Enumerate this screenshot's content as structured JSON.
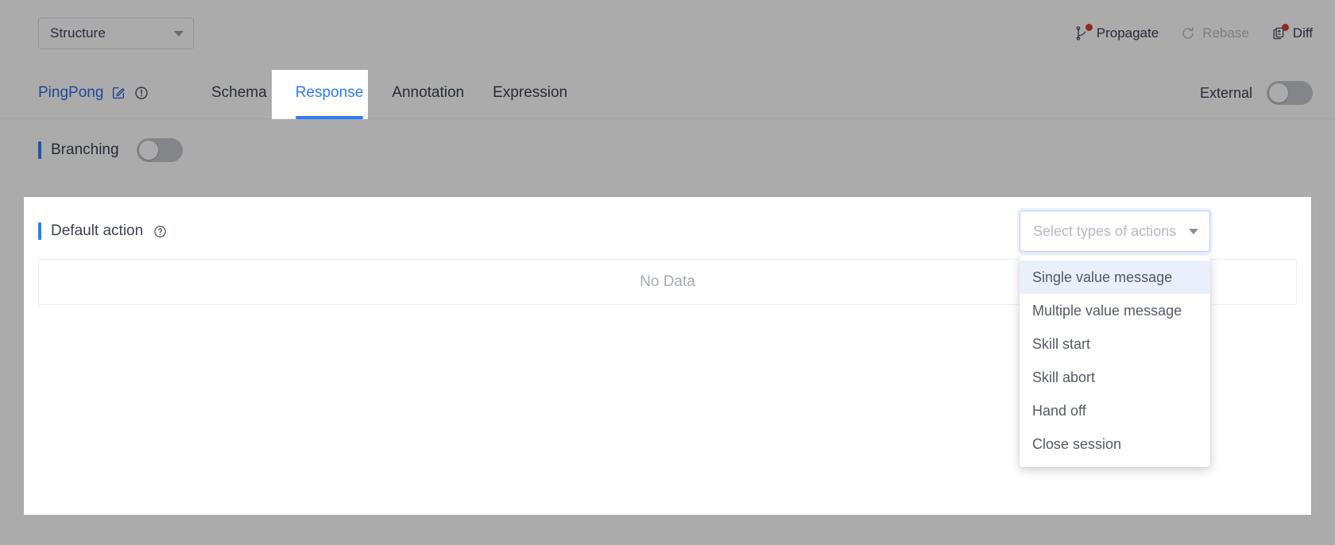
{
  "topbar": {
    "structure_select": {
      "value": "Structure",
      "caret_icon": "chevron-down-icon"
    },
    "actions": [
      {
        "label": "Propagate",
        "icon": "branch-icon",
        "badge": true,
        "disabled": false
      },
      {
        "label": "Rebase",
        "icon": "refresh-icon",
        "badge": false,
        "disabled": true
      },
      {
        "label": "Diff",
        "icon": "diff-document-icon",
        "badge": true,
        "disabled": false
      }
    ]
  },
  "tabbar": {
    "node_name": "PingPong",
    "edit_icon": "edit-pencil-square-icon",
    "warning_icon": "exclamation-circle-icon",
    "tabs": [
      {
        "label": "Schema",
        "active": false
      },
      {
        "label": "Response",
        "active": true
      },
      {
        "label": "Annotation",
        "active": false
      },
      {
        "label": "Expression",
        "active": false
      }
    ],
    "external": {
      "label": "External",
      "enabled": false
    }
  },
  "branching": {
    "label": "Branching",
    "enabled": false
  },
  "card": {
    "default_action": {
      "label": "Default action",
      "help_icon": "question-circle-icon"
    },
    "table": {
      "empty_text": "No Data"
    }
  },
  "action_select": {
    "placeholder": "Select types of actions",
    "caret_icon": "chevron-down-icon",
    "open": true,
    "options": [
      {
        "label": "Single value message",
        "selected": true
      },
      {
        "label": "Multiple value message",
        "selected": false
      },
      {
        "label": "Skill start",
        "selected": false
      },
      {
        "label": "Skill abort",
        "selected": false
      },
      {
        "label": "Hand off",
        "selected": false
      },
      {
        "label": "Close session",
        "selected": false
      }
    ]
  },
  "colors": {
    "accent": "#2f7cf6",
    "link": "#2f6fe0",
    "badge": "#d93b34",
    "text": "#3c4257",
    "muted": "#a7abb6",
    "scrim": "#000000"
  }
}
